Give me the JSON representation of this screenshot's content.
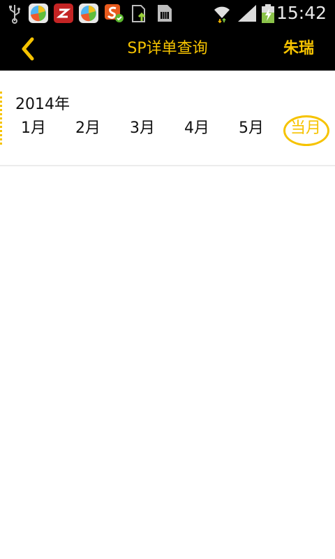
{
  "status_bar": {
    "time": "15:42",
    "icons": [
      "usb-icon",
      "app-store-icon",
      "z-app-icon",
      "app-store-icon",
      "s-app-icon",
      "upload-icon",
      "sim-card-icon",
      "wifi-icon",
      "signal-icon",
      "battery-charging-icon"
    ]
  },
  "header": {
    "title": "SP详单查询",
    "user": "朱瑞",
    "back_icon": "chevron-left-icon"
  },
  "panel": {
    "year": "2014年",
    "months": [
      "1月",
      "2月",
      "3月",
      "4月",
      "5月",
      "当月"
    ],
    "selected": "当月"
  },
  "colors": {
    "accent": "#f6c300",
    "bar": "#000000"
  }
}
